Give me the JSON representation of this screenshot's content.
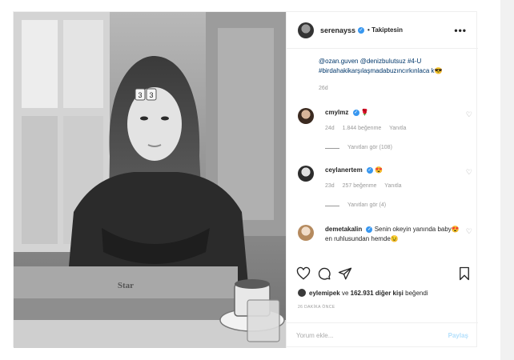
{
  "post": {
    "username": "serenayss",
    "follow_status": "• Takiptesin",
    "more_label": "•••",
    "caption": "@ozan.guven @denizbulutsuz #4-U #birdahakikarşılaşmadabuzıncırkınlaca k😎",
    "caption_age": "26d",
    "comments": [
      {
        "user": "cmylmz",
        "text": "🌹",
        "age": "24d",
        "likes": "1.844 beğenme",
        "reply": "Yanıtla",
        "view_replies": "Yanıtları gör (108)"
      },
      {
        "user": "ceylanertem",
        "text": "😍",
        "age": "23d",
        "likes": "257 beğenme",
        "reply": "Yanıtla",
        "view_replies": "Yanıtları gör (4)"
      },
      {
        "user": "demetakalin",
        "text": "Senin okeyin yanında baby😍en ruhlusundan hemde😉"
      }
    ],
    "liked_by": {
      "user": "eylemipek",
      "connector": "ve",
      "rest": "162.931 diğer kişi",
      "suffix": "beğendi"
    },
    "time_ago": "26 DAKİKA ÖNCE",
    "comment_placeholder": "Yorum ekle...",
    "share_label": "Paylaş",
    "laptop_logo": "Star",
    "tile_text": "3"
  },
  "colors": {
    "verified": "#3897f0",
    "link": "#00376b",
    "muted": "#999999"
  },
  "icons": [
    "more-icon",
    "verified-badge-icon",
    "heart-icon",
    "comment-icon",
    "share-icon",
    "bookmark-icon"
  ]
}
